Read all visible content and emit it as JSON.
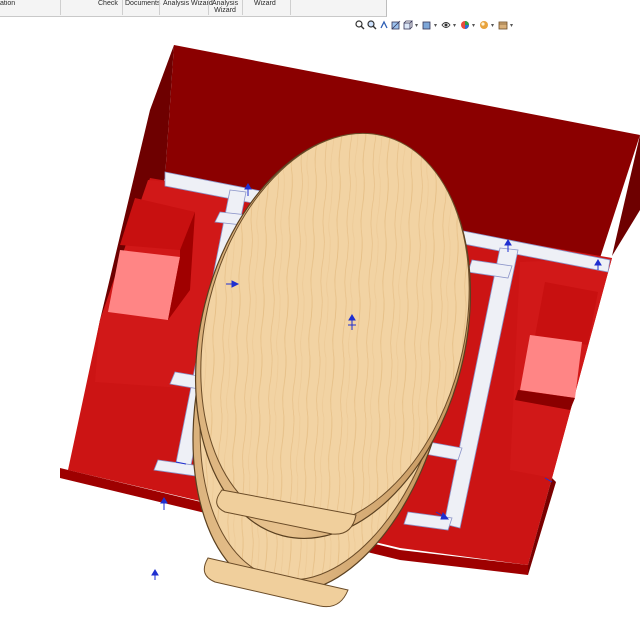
{
  "ribbon": {
    "items": [
      {
        "label": "ation"
      },
      {
        "label": "Check"
      },
      {
        "label": "Documents"
      },
      {
        "label": "Analysis Wizard"
      },
      {
        "label": "Analysis\nWizard"
      },
      {
        "label": "Wizard"
      }
    ]
  },
  "heads_up_toolbar": {
    "icons": [
      "zoom-to-fit-icon",
      "zoom-to-area-icon",
      "previous-view-icon",
      "section-view-icon",
      "view-orientation-icon",
      "display-style-icon",
      "hide-show-items-icon",
      "edit-appearance-icon",
      "apply-scene-icon",
      "view-settings-icon"
    ]
  },
  "colors": {
    "red_base": "#cc1414",
    "dark_red_wall": "#8b0000",
    "board_wood": "#f2d3a3",
    "frame_white": "#eef0f6",
    "frame_blue_edge": "#8c95c9",
    "pink_block": "#ff8585",
    "sketch_blue": "#1f2fd0"
  }
}
